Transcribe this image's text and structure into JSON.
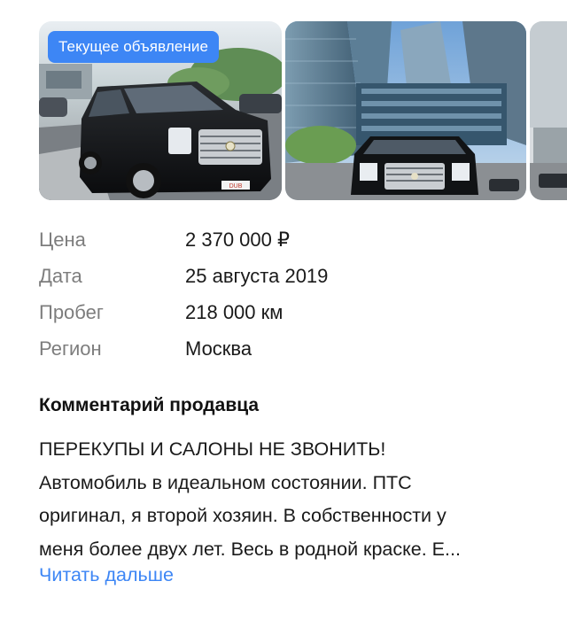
{
  "gallery": {
    "current_badge": "Текущее объявление",
    "plate_text": "DUB"
  },
  "specs": [
    {
      "label": "Цена",
      "value": "2 370 000 ₽"
    },
    {
      "label": "Дата",
      "value": "25 августа 2019"
    },
    {
      "label": "Пробег",
      "value": "218 000 км"
    },
    {
      "label": "Регион",
      "value": "Москва"
    }
  ],
  "comment": {
    "title": "Комментарий продавца",
    "lines": [
      "ПЕРЕКУПЫ И САЛОНЫ НЕ ЗВОНИТЬ!",
      "Автомобиль в идеальном состоянии. ПТС",
      "оригинал, я второй хозяин. В собственности у",
      "меня более двух лет. Весь в родной краске. Е..."
    ],
    "read_more": "Читать дальше"
  },
  "colors": {
    "accent": "#3d86f5",
    "label_gray": "#7d7d7d"
  }
}
